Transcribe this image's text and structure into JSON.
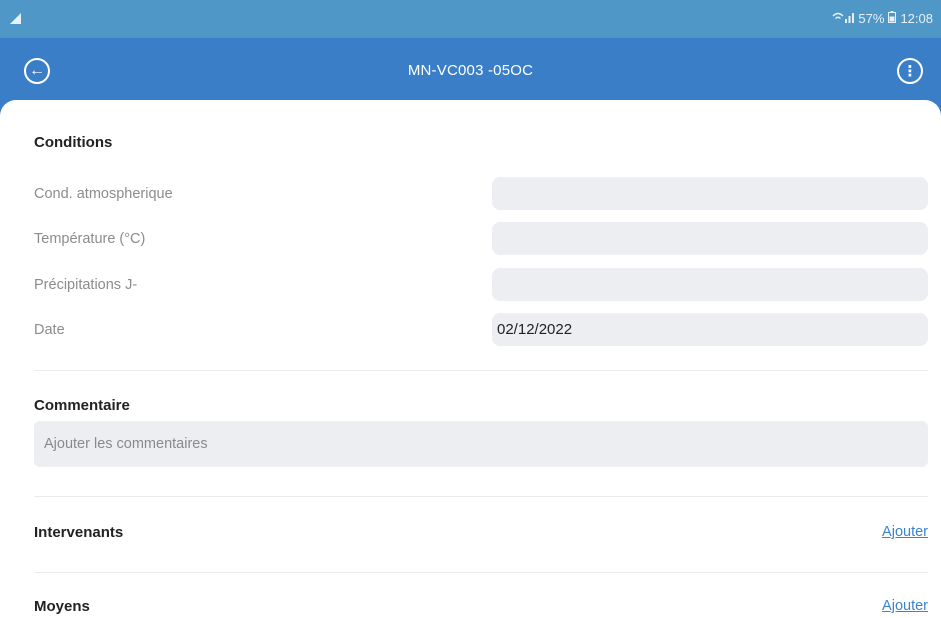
{
  "status_bar": {
    "signal_text": "⫆ .∥",
    "battery": "57%",
    "time": "12:08"
  },
  "app_bar": {
    "title": "MN-VC003 -05OC"
  },
  "conditions": {
    "title": "Conditions",
    "fields": [
      {
        "label": "Cond. atmospherique",
        "value": ""
      },
      {
        "label": "Température (°C)",
        "value": ""
      },
      {
        "label": "Précipitations J-",
        "value": ""
      },
      {
        "label": "Date",
        "value": "02/12/2022"
      }
    ]
  },
  "comment": {
    "title": "Commentaire",
    "placeholder": "Ajouter les commentaires"
  },
  "intervenants": {
    "title": "Intervenants",
    "action": "Ajouter"
  },
  "moyens": {
    "title": "Moyens",
    "action": "Ajouter"
  },
  "colors": {
    "app_bar": "#3a7ec8",
    "status_bar": "#4f97c6",
    "link": "#3a84c9",
    "field_bg": "#eceef2"
  }
}
